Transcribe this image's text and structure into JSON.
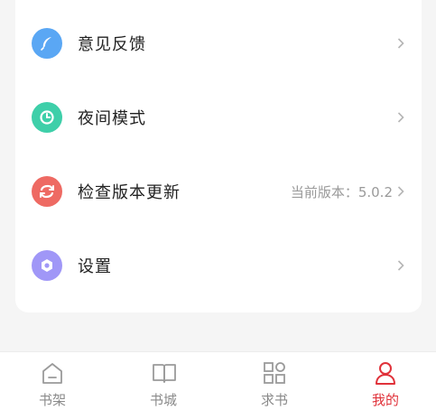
{
  "colors": {
    "feedback_icon_bg": "#5aa7f4",
    "night_icon_bg": "#3ecfa9",
    "update_icon_bg": "#ee6a63",
    "settings_icon_bg": "#a097f7",
    "active_tab": "#e0323a",
    "inactive_tab": "#8a8a8a"
  },
  "menu": {
    "items": [
      {
        "label": "意见反馈",
        "icon": "feather-icon",
        "value": ""
      },
      {
        "label": "夜间模式",
        "icon": "moon-icon",
        "value": ""
      },
      {
        "label": "检查版本更新",
        "icon": "refresh-icon",
        "value": "当前版本：5.0.2"
      },
      {
        "label": "设置",
        "icon": "hexagon-gear-icon",
        "value": ""
      }
    ]
  },
  "tabbar": {
    "active_index": 3,
    "tabs": [
      {
        "label": "书架",
        "icon": "home-icon"
      },
      {
        "label": "书城",
        "icon": "open-book-icon"
      },
      {
        "label": "求书",
        "icon": "grid-icon"
      },
      {
        "label": "我的",
        "icon": "person-icon"
      }
    ]
  }
}
